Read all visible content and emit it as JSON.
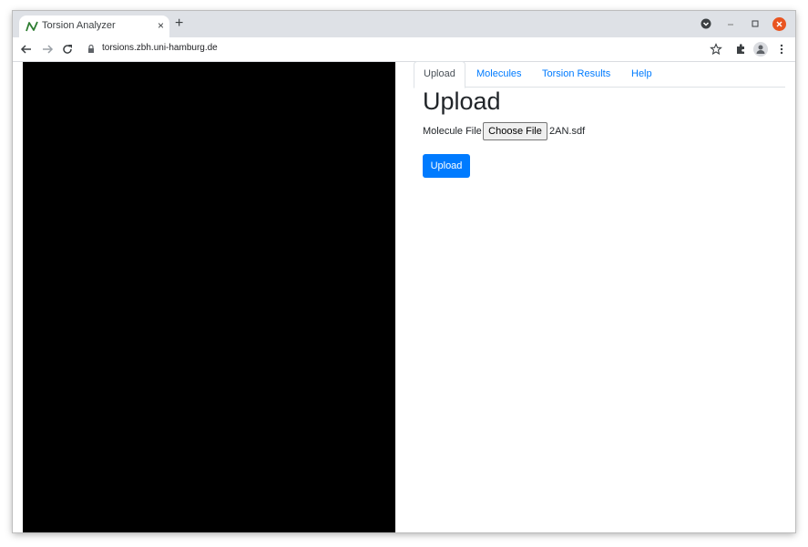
{
  "browser": {
    "tab_title": "Torsion Analyzer",
    "tab_close": "×",
    "new_tab": "+",
    "url": "torsions.zbh.uni-hamburg.de"
  },
  "nav": {
    "tabs": [
      {
        "label": "Upload",
        "active": true
      },
      {
        "label": "Molecules",
        "active": false
      },
      {
        "label": "Torsion Results",
        "active": false
      },
      {
        "label": "Help",
        "active": false
      }
    ]
  },
  "main": {
    "heading": "Upload",
    "file_label": "Molecule File",
    "choose_file_label": "Choose File",
    "file_name": "2AN.sdf",
    "upload_button": "Upload"
  },
  "icons": {
    "favicon": "torsion-analyzer-favicon",
    "tab_search": "tab-search-icon",
    "minimize": "minimize-icon",
    "maximize": "maximize-icon",
    "close": "close-icon",
    "back": "back-arrow-icon",
    "forward": "forward-arrow-icon",
    "reload": "reload-icon",
    "lock": "lock-icon",
    "star": "bookmark-star-icon",
    "extensions": "puzzle-extensions-icon",
    "profile": "profile-avatar-icon",
    "menu": "kebab-menu-icon"
  },
  "colors": {
    "primary": "#007bff",
    "close_window": "#e95420",
    "viewer_background": "#000000"
  }
}
